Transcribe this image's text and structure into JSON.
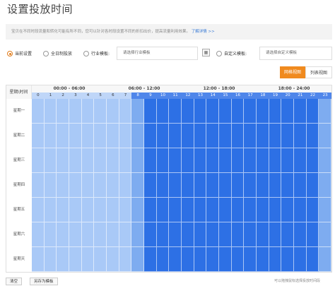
{
  "title": "设置投放时间",
  "tip": {
    "text": "宝贝在不同时段流量和转化可能有所不同，您可以针对各时段设置不同的折扣出价，提高流量利用效果。",
    "link": "了解详情 >>"
  },
  "options": {
    "current": "当前设置",
    "allday": "全日制投放",
    "industry": "行业模板:",
    "industry_placeholder": "请选择行业模板",
    "custom": "自定义模板:",
    "custom_placeholder": "请选择自定义模板",
    "calendar_icon": "calendar-icon",
    "selected": "current"
  },
  "view_tabs": {
    "grid": "网格视图",
    "list": "列表视图",
    "active": "grid"
  },
  "grid": {
    "corner": "星期\\时间",
    "blocks": [
      "00:00 - 06:00",
      "06:00 - 12:00",
      "12:00 - 18:00",
      "18:00 - 24:00"
    ],
    "hours": [
      "0",
      "1",
      "2",
      "3",
      "4",
      "5",
      "6",
      "7",
      "8",
      "9",
      "10",
      "11",
      "12",
      "13",
      "14",
      "15",
      "16",
      "17",
      "18",
      "19",
      "20",
      "21",
      "22",
      "23"
    ],
    "days": [
      "星期一",
      "星期二",
      "星期三",
      "星期四",
      "星期五",
      "星期六",
      "星期天"
    ],
    "hour_levels": [
      "light",
      "light",
      "light",
      "light",
      "light",
      "light",
      "light",
      "light",
      "mid",
      "dark",
      "dark",
      "dark",
      "dark",
      "dark",
      "dark",
      "dark",
      "dark",
      "dark",
      "dark",
      "dark",
      "dark",
      "dark",
      "dark",
      "mid"
    ],
    "colors": {
      "light": "#a9c9f7",
      "mid": "#7eacf0",
      "dark": "#2d70e5",
      "header_light": "#bfd6f8",
      "header_dark": "#4f86ea"
    }
  },
  "footer": {
    "clear": "清空",
    "save_template": "另存为模板",
    "hint": "可以拖拽鼠标选择投放时间段"
  }
}
